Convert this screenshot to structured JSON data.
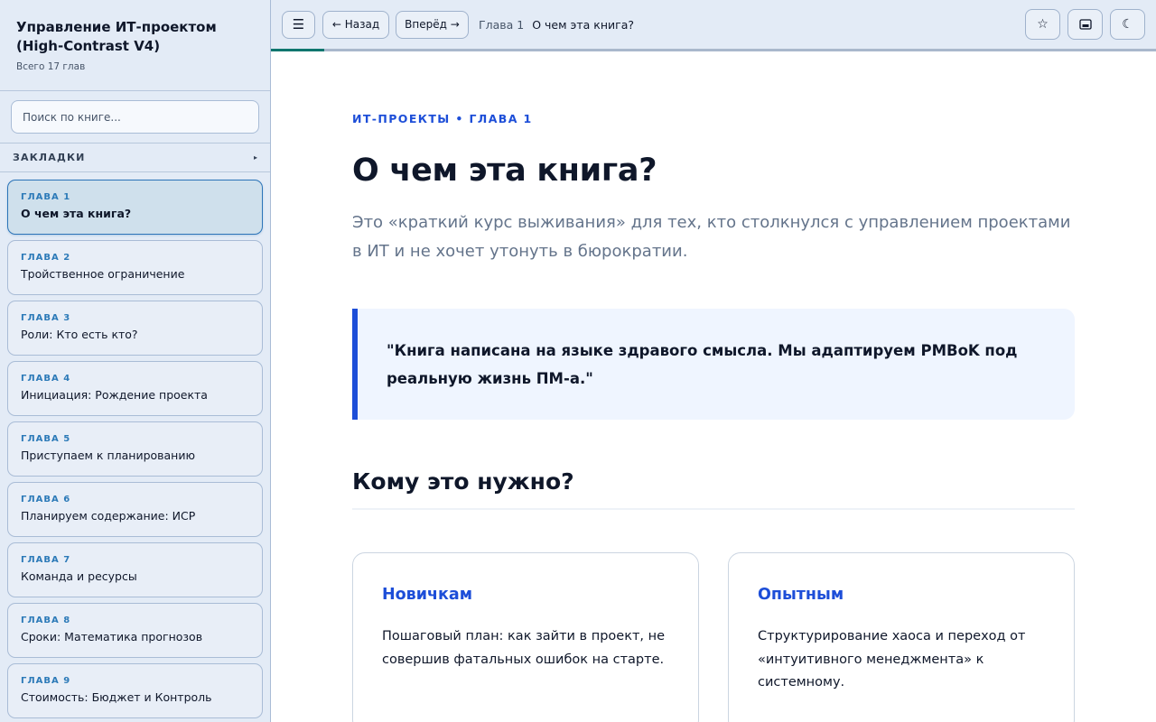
{
  "sidebar": {
    "title": "Управление ИТ-проектом (High-Contrast V4)",
    "subtitle": "Всего 17 глав",
    "search_placeholder": "Поиск по книге...",
    "bookmarks_label": "ЗАКЛАДКИ",
    "bookmarks_arrow": "▸",
    "chapters": [
      {
        "num": "ГЛАВА 1",
        "title": "О чем эта книга?",
        "active": true
      },
      {
        "num": "ГЛАВА 2",
        "title": "Тройственное ограничение"
      },
      {
        "num": "ГЛАВА 3",
        "title": "Роли: Кто есть кто?"
      },
      {
        "num": "ГЛАВА 4",
        "title": "Инициация: Рождение проекта"
      },
      {
        "num": "ГЛАВА 5",
        "title": "Приступаем к планированию"
      },
      {
        "num": "ГЛАВА 6",
        "title": "Планируем содержание: ИСР"
      },
      {
        "num": "ГЛАВА 7",
        "title": "Команда и ресурсы"
      },
      {
        "num": "ГЛАВА 8",
        "title": "Сроки: Математика прогнозов"
      },
      {
        "num": "ГЛАВА 9",
        "title": "Стоимость: Бюджет и Контроль"
      }
    ]
  },
  "topbar": {
    "menu_icon": "☰",
    "back_label": "← Назад",
    "forward_label": "Вперёд →",
    "crumb_chapter": "Глава 1",
    "crumb_title": "О чем эта книга?",
    "star_icon": "☆",
    "image_icon": "▭",
    "moon_icon": "☾",
    "progress": 0.06
  },
  "main": {
    "kicker": "ИТ-ПРОЕКТЫ • ГЛАВА 1",
    "title": "О чем эта книга?",
    "lead": "Это «краткий курс выживания» для тех, кто столкнулся с управлением проектами в ИТ и не хочет утонуть в бюрократии.",
    "quote": "\"Книга написана на языке здравого смысла. Мы адаптируем PMBoK под реальную жизнь ПМ-а.\"",
    "section_title": "Кому это нужно?",
    "cards": [
      {
        "title": "Новичкам",
        "text": "Пошаговый план: как зайти в проект, не совершив фатальных ошибок на старте."
      },
      {
        "title": "Опытным",
        "text": "Структурирование хаоса и переход от «интуитивного менеджмента» к системному."
      }
    ]
  },
  "colors": {
    "accent": "#1d4ed8",
    "progress": "#0f766e",
    "sidebar_bg": "#e3ebf6",
    "active_chapter": "#cfe0ec"
  }
}
